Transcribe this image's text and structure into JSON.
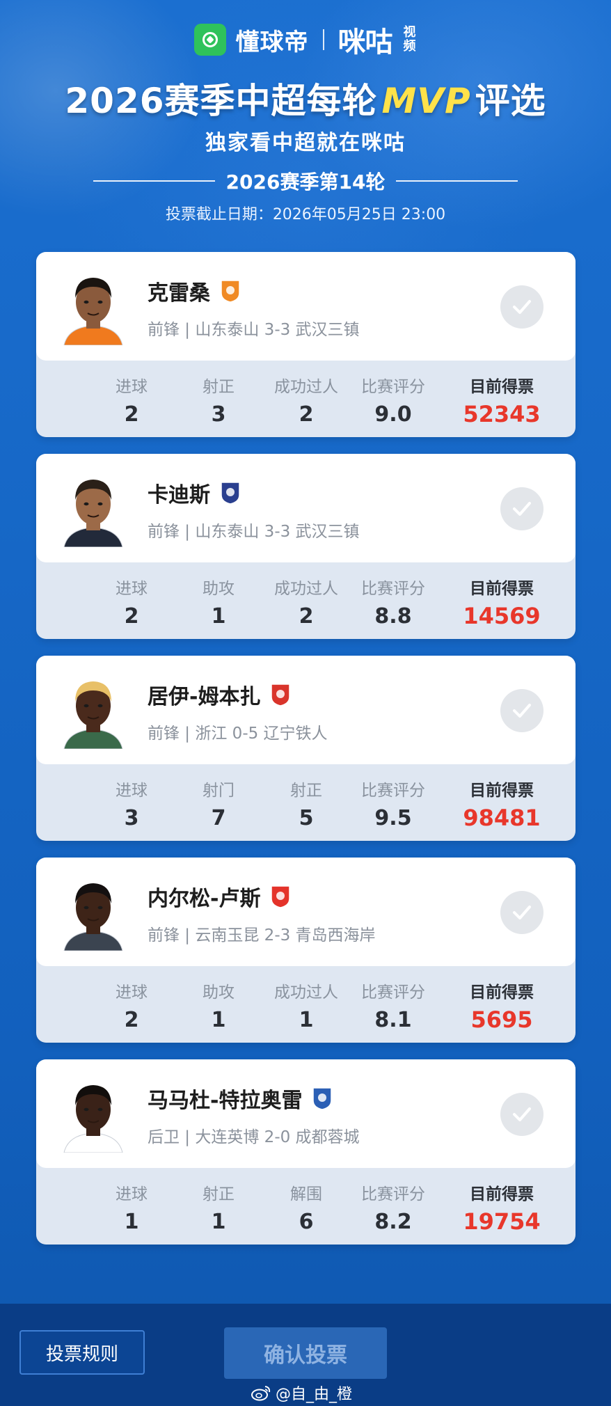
{
  "brand": {
    "name1": "懂球帝",
    "name2": "咪咕",
    "name2_sub": "视频"
  },
  "header": {
    "title_pre": "2026赛季中超每轮",
    "title_mvp": "MVP",
    "title_post": "评选",
    "subtitle": "独家看中超就在咪咕",
    "round": "2026赛季第14轮",
    "deadline": "投票截止日期：2026年05月25日 23:00"
  },
  "players": [
    {
      "name": "克雷桑",
      "info": "前锋 | 山东泰山 3-3 武汉三镇",
      "stats": [
        {
          "label": "进球",
          "value": "2"
        },
        {
          "label": "射正",
          "value": "3"
        },
        {
          "label": "成功过人",
          "value": "2"
        },
        {
          "label": "比赛评分",
          "value": "9.0"
        }
      ],
      "votes_label": "目前得票",
      "votes": "52343",
      "badge_color": "#f08a24",
      "skin": "#8a5a3c",
      "hair": "#1a1410",
      "shirt": "#f07a1e"
    },
    {
      "name": "卡迪斯",
      "info": "前锋 | 山东泰山 3-3 武汉三镇",
      "stats": [
        {
          "label": "进球",
          "value": "2"
        },
        {
          "label": "助攻",
          "value": "1"
        },
        {
          "label": "成功过人",
          "value": "2"
        },
        {
          "label": "比赛评分",
          "value": "8.8"
        }
      ],
      "votes_label": "目前得票",
      "votes": "14569",
      "badge_color": "#2a3f8f",
      "skin": "#9c6a48",
      "hair": "#2a2018",
      "shirt": "#222a3a"
    },
    {
      "name": "居伊-姆本扎",
      "info": "前锋 | 浙江 0-5 辽宁铁人",
      "stats": [
        {
          "label": "进球",
          "value": "3"
        },
        {
          "label": "射门",
          "value": "7"
        },
        {
          "label": "射正",
          "value": "5"
        },
        {
          "label": "比赛评分",
          "value": "9.5"
        }
      ],
      "votes_label": "目前得票",
      "votes": "98481",
      "badge_color": "#d9342b",
      "skin": "#4a2a1c",
      "hair": "#e8c068",
      "shirt": "#3a6a4a"
    },
    {
      "name": "内尔松-卢斯",
      "info": "前锋 | 云南玉昆 2-3 青岛西海岸",
      "stats": [
        {
          "label": "进球",
          "value": "2"
        },
        {
          "label": "助攻",
          "value": "1"
        },
        {
          "label": "成功过人",
          "value": "1"
        },
        {
          "label": "比赛评分",
          "value": "8.1"
        }
      ],
      "votes_label": "目前得票",
      "votes": "5695",
      "badge_color": "#e4332a",
      "skin": "#3e2418",
      "hair": "#141010",
      "shirt": "#3b4450"
    },
    {
      "name": "马马杜-特拉奥雷",
      "info": "后卫 | 大连英博 2-0 成都蓉城",
      "stats": [
        {
          "label": "进球",
          "value": "1"
        },
        {
          "label": "射正",
          "value": "1"
        },
        {
          "label": "解围",
          "value": "6"
        },
        {
          "label": "比赛评分",
          "value": "8.2"
        }
      ],
      "votes_label": "目前得票",
      "votes": "19754",
      "badge_color": "#2b5fb5",
      "skin": "#3a2218",
      "hair": "#120e0c",
      "shirt": "#ffffff"
    }
  ],
  "footer": {
    "rules": "投票规则",
    "confirm": "确认投票",
    "watermark": "@自_由_橙"
  }
}
